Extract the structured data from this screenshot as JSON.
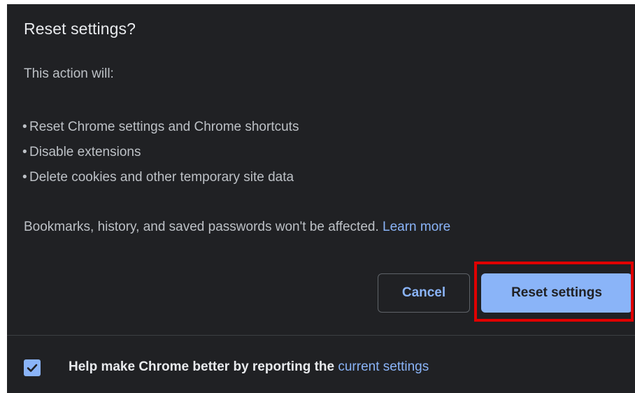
{
  "dialog": {
    "title": "Reset settings?",
    "intro": "This action will:",
    "bullets": [
      "Reset Chrome settings and Chrome shortcuts",
      "Disable extensions",
      "Delete cookies and other temporary site data"
    ],
    "bullet_glyph": "•",
    "note": "Bookmarks, history, and saved passwords won't be affected.",
    "learn_more": "Learn more",
    "cancel_label": "Cancel",
    "reset_label": "Reset settings"
  },
  "footer": {
    "checkbox_checked": true,
    "text": "Help make Chrome better by reporting the",
    "link": "current settings"
  },
  "colors": {
    "background": "#202124",
    "text": "#bdc1c6",
    "title": "#e8eaed",
    "accent": "#8ab4f8",
    "highlight": "#e00000"
  },
  "icons": {
    "checkbox": "check-icon"
  }
}
